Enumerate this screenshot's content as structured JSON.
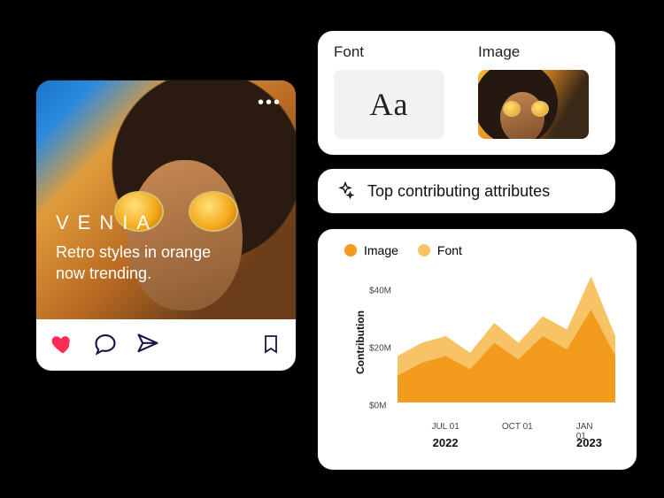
{
  "post": {
    "brand": "VENIA",
    "tagline": "Retro styles in orange now trending.",
    "more_icon": "•••"
  },
  "fi": {
    "font_label": "Font",
    "image_label": "Image",
    "font_sample": "Aa"
  },
  "attributes": {
    "title": "Top contributing attributes"
  },
  "chart": {
    "legend": {
      "image": "Image",
      "font": "Font"
    },
    "ylabel": "Contribution",
    "yticks": [
      "$40M",
      "$20M",
      "$0M"
    ],
    "xticks": [
      "JUL 01",
      "OCT 01",
      "JAN 01"
    ],
    "years": {
      "left": "2022",
      "right": "2023"
    },
    "colors": {
      "image": "#F29B1D",
      "font": "#F8C366"
    }
  },
  "chart_data": {
    "type": "area",
    "title": "",
    "xlabel": "",
    "ylabel": "Contribution",
    "ylim": [
      0,
      40
    ],
    "yunit": "$M",
    "x": [
      "2022-05",
      "2022-06",
      "2022-07",
      "2022-08",
      "2022-09",
      "2022-10",
      "2022-11",
      "2022-12",
      "2023-01",
      "2023-02"
    ],
    "x_tick_labels": [
      "JUL 01",
      "OCT 01",
      "JAN 01"
    ],
    "series": [
      {
        "name": "Image",
        "color": "#F29B1D",
        "values": [
          8,
          12,
          14,
          10,
          18,
          13,
          20,
          16,
          28,
          14
        ]
      },
      {
        "name": "Font",
        "color": "#F8C366",
        "values": [
          14,
          18,
          20,
          15,
          24,
          18,
          26,
          22,
          38,
          20
        ]
      }
    ],
    "stacked": false,
    "legend_position": "top-left"
  }
}
